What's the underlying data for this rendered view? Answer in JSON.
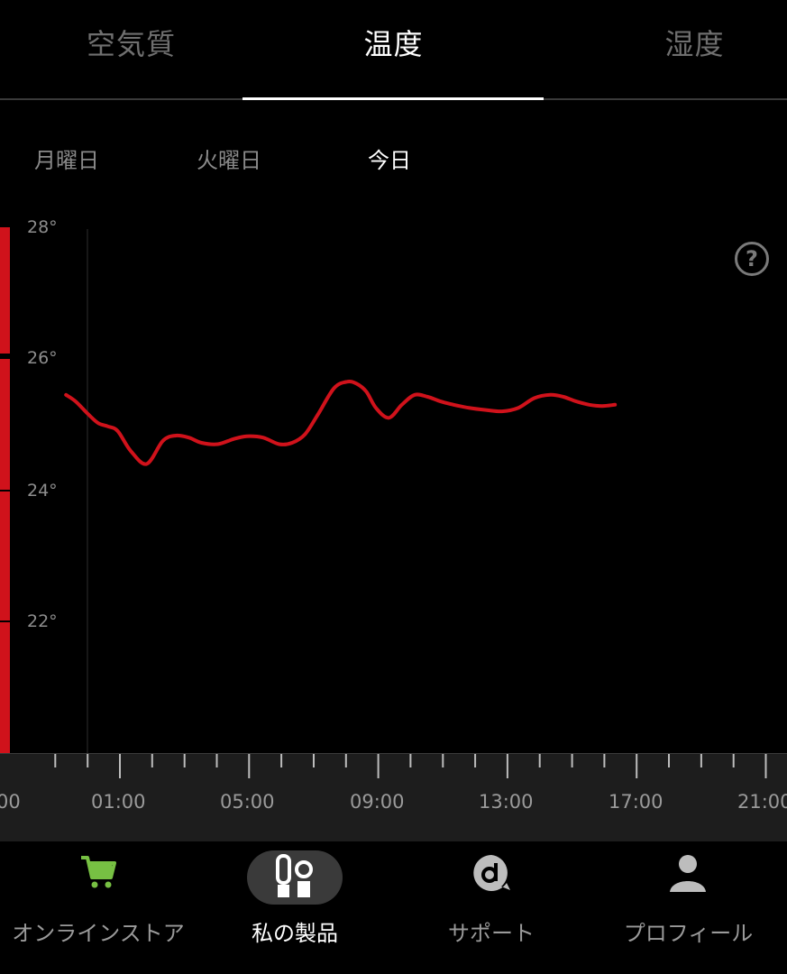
{
  "top_tabs": [
    {
      "label": "空気質",
      "active": false
    },
    {
      "label": "温度",
      "active": true
    },
    {
      "label": "湿度",
      "active": false
    }
  ],
  "day_tabs": [
    {
      "label": "月曜日",
      "active": false
    },
    {
      "label": "火曜日",
      "active": false
    },
    {
      "label": "今日",
      "active": true
    }
  ],
  "chart_data": {
    "type": "line",
    "ylabel": "",
    "yticks": [
      "28°",
      "26°",
      "24°",
      "22°"
    ],
    "ylim": [
      20,
      28
    ],
    "series": [
      {
        "color": "#d0121b",
        "x": [
          0.0,
          0.3,
          0.7,
          1.0,
          1.3,
          1.6,
          2.0,
          2.5,
          3.0,
          3.4,
          3.8,
          4.2,
          4.7,
          5.2,
          5.6,
          6.1,
          6.6,
          7.0,
          7.4,
          7.8,
          8.3,
          8.7,
          9.0,
          9.3,
          9.6,
          10.0,
          10.4,
          10.8,
          11.2,
          11.6,
          12.0,
          12.5,
          13.0,
          13.5,
          14.0,
          14.5,
          15.0,
          15.4,
          15.8,
          16.2,
          16.6,
          17.0
        ],
        "y": [
          25.45,
          25.35,
          25.15,
          25.02,
          24.97,
          24.9,
          24.6,
          24.4,
          24.75,
          24.83,
          24.8,
          24.72,
          24.7,
          24.78,
          24.82,
          24.8,
          24.7,
          24.72,
          24.85,
          25.15,
          25.55,
          25.65,
          25.62,
          25.5,
          25.25,
          25.1,
          25.3,
          25.45,
          25.42,
          25.35,
          25.3,
          25.25,
          25.22,
          25.2,
          25.25,
          25.4,
          25.45,
          25.42,
          25.35,
          25.3,
          25.28,
          25.3
        ]
      }
    ],
    "grid": false
  },
  "timeline": {
    "labels": [
      "00",
      "01:00",
      "05:00",
      "09:00",
      "13:00",
      "17:00",
      "21:00"
    ]
  },
  "help_glyph": "?",
  "colors": {
    "accent": "#d0121b",
    "cart_green": "#77c043"
  },
  "bottom_nav": [
    {
      "label": "オンラインストア",
      "icon": "cart-icon",
      "active": false
    },
    {
      "label": "私の製品",
      "icon": "products-icon",
      "active": true
    },
    {
      "label": "サポート",
      "icon": "support-icon",
      "active": false
    },
    {
      "label": "プロフィール",
      "icon": "profile-icon",
      "active": false
    }
  ]
}
